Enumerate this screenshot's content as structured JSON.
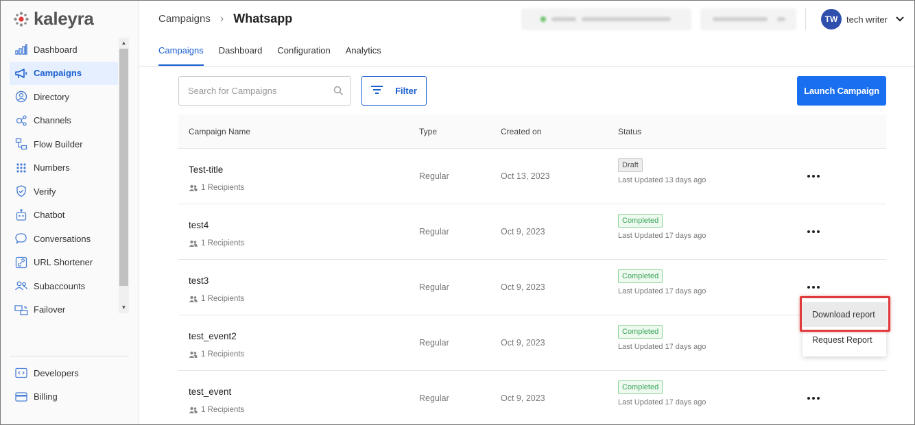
{
  "app": {
    "logo_text": "kaleyra"
  },
  "sidebar": {
    "items": [
      {
        "label": "Dashboard",
        "icon": "bar-chart-icon",
        "active": false
      },
      {
        "label": "Campaigns",
        "icon": "megaphone-icon",
        "active": true
      },
      {
        "label": "Directory",
        "icon": "contact-icon",
        "active": false
      },
      {
        "label": "Channels",
        "icon": "channels-icon",
        "active": false
      },
      {
        "label": "Flow Builder",
        "icon": "flow-icon",
        "active": false
      },
      {
        "label": "Numbers",
        "icon": "dialpad-icon",
        "active": false
      },
      {
        "label": "Verify",
        "icon": "shield-icon",
        "active": false
      },
      {
        "label": "Chatbot",
        "icon": "robot-icon",
        "active": false
      },
      {
        "label": "Conversations",
        "icon": "chat-bubble-icon",
        "active": false
      },
      {
        "label": "URL Shortener",
        "icon": "link-icon",
        "active": false
      },
      {
        "label": "Subaccounts",
        "icon": "people-icon",
        "active": false
      },
      {
        "label": "Failover",
        "icon": "failover-icon",
        "active": false
      }
    ],
    "bottom_items": [
      {
        "label": "Developers",
        "icon": "code-icon"
      },
      {
        "label": "Billing",
        "icon": "card-icon"
      }
    ]
  },
  "header": {
    "breadcrumb_parent": "Campaigns",
    "breadcrumb_current": "Whatsapp",
    "user_initials": "TW",
    "user_name": "tech writer",
    "tabs": [
      "Campaigns",
      "Dashboard",
      "Configuration",
      "Analytics"
    ],
    "active_tab": "Campaigns"
  },
  "toolbar": {
    "search_placeholder": "Search for Campaigns",
    "filter_label": "Filter",
    "launch_label": "Launch Campaign"
  },
  "table": {
    "columns": [
      "Campaign Name",
      "Type",
      "Created on",
      "Status"
    ],
    "rows": [
      {
        "name": "Test-title",
        "recipients": "1 Recipients",
        "type": "Regular",
        "created": "Oct 13, 2023",
        "status": "Draft",
        "updated": "Last Updated 13 days ago"
      },
      {
        "name": "test4",
        "recipients": "1 Recipients",
        "type": "Regular",
        "created": "Oct 9, 2023",
        "status": "Completed",
        "updated": "Last Updated 17 days ago"
      },
      {
        "name": "test3",
        "recipients": "1 Recipients",
        "type": "Regular",
        "created": "Oct 9, 2023",
        "status": "Completed",
        "updated": "Last Updated 17 days ago"
      },
      {
        "name": "test_event2",
        "recipients": "1 Recipients",
        "type": "Regular",
        "created": "Oct 9, 2023",
        "status": "Completed",
        "updated": "Last Updated 17 days ago"
      },
      {
        "name": "test_event",
        "recipients": "1 Recipients",
        "type": "Regular",
        "created": "Oct 9, 2023",
        "status": "Completed",
        "updated": "Last Updated 17 days ago"
      }
    ]
  },
  "row_menu": {
    "items": [
      "Download report",
      "Request Report"
    ],
    "highlighted": "Download report"
  },
  "colors": {
    "accent": "#1a5fd0",
    "primary_button": "#1a6ff0",
    "completed": "#3aa457",
    "highlight_border": "#e03b3b",
    "avatar": "#2f4fad"
  }
}
